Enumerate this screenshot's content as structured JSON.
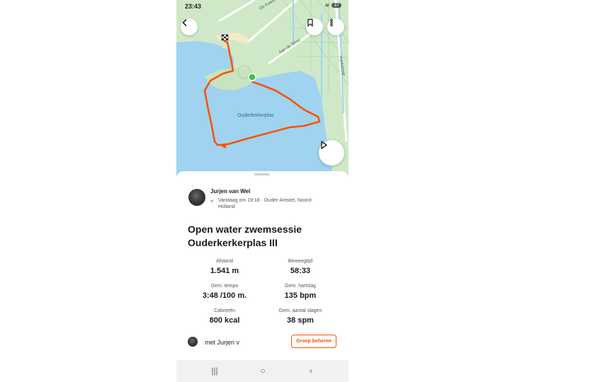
{
  "status_bar": {
    "time": "23:43",
    "battery": "37"
  },
  "map": {
    "labels": {
      "street_top": "Op Koers",
      "street_right": "Aan de Wind",
      "street_edge": "Kerkstraat",
      "lake": "Ouderkerkerplas"
    },
    "colors": {
      "water": "#9fd3ef",
      "land": "#cfe9c8",
      "route": "#fc5200",
      "start": "#34c24a"
    },
    "buttons": {
      "back_icon": "back-arrow-icon",
      "bookmark_icon": "bookmark-icon",
      "more_icon": "more-vertical-icon",
      "play_icon": "play-icon"
    }
  },
  "activity": {
    "athlete": "Jurjen van Wel",
    "meta": "Vandaag om 19:18 · Ouder-Amstel, Noord-Holland",
    "title": "Open water zwemsessie Ouderkerkerplas III",
    "stats": [
      {
        "label": "Afstand",
        "value": "1.541 m"
      },
      {
        "label": "Beweegtijd",
        "value": "58:33"
      },
      {
        "label": "Gem. tempo",
        "value": "3:48 /100 m."
      },
      {
        "label": "Gem. hartslag",
        "value": "135 bpm"
      },
      {
        "label": "Calorieën",
        "value": "800 kcal"
      },
      {
        "label": "Gem. aantal slagen",
        "value": "38 spm"
      }
    ],
    "with_text": "met Jurjen v",
    "group_button": "Groep beheren",
    "accent": "#fc5200"
  },
  "nav_bar": {
    "recents": "|||",
    "home": "○",
    "back": "‹"
  }
}
